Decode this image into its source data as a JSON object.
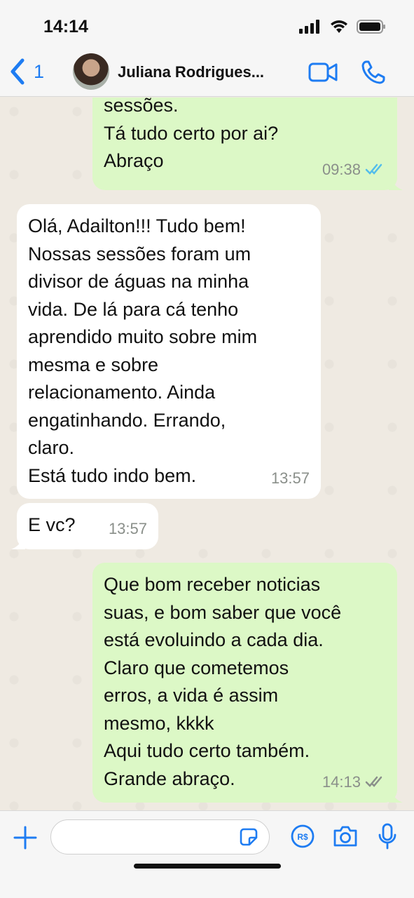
{
  "status_bar": {
    "time": "14:14"
  },
  "header": {
    "back_count": "1",
    "contact_name": "Juliana Rodrigues..."
  },
  "messages": [
    {
      "direction": "outgoing",
      "text": "sessões.\nTá tudo certo por ai?\nAbraço",
      "time": "09:38",
      "status": "read"
    },
    {
      "direction": "incoming",
      "text": "Olá, Adailton!!! Tudo bem!\nNossas sessões foram um\ndivisor de águas na minha\nvida. De lá para cá tenho\naprendido muito sobre mim\nmesma e sobre\nrelacionamento. Ainda\nengatinhando. Errando,\nclaro.\nEstá tudo indo bem.",
      "time": "13:57"
    },
    {
      "direction": "incoming",
      "text": "E vc?",
      "time": "13:57"
    },
    {
      "direction": "outgoing",
      "text": "Que bom receber noticias\nsuas, e bom saber que você\nestá evoluindo a cada dia.\nClaro que cometemos\nerros, a vida é assim\nmesmo, kkkk\nAqui tudo certo também.\nGrande abraço.",
      "time": "14:13",
      "status": "delivered"
    }
  ],
  "input": {
    "placeholder": "",
    "value": ""
  },
  "icons": {
    "back": "chevron-left-icon",
    "video": "video-camera-icon",
    "call": "phone-icon",
    "attach": "plus-icon",
    "sticker": "sticker-icon",
    "payment": "pix-real-icon",
    "camera": "camera-icon",
    "mic": "microphone-icon"
  },
  "colors": {
    "accent": "#1e7cf2",
    "outgoing_bubble": "#dcf8c6",
    "incoming_bubble": "#ffffff",
    "read_check": "#53bdeb",
    "delivered_check": "#8a8f8a",
    "background": "#efeae2"
  }
}
